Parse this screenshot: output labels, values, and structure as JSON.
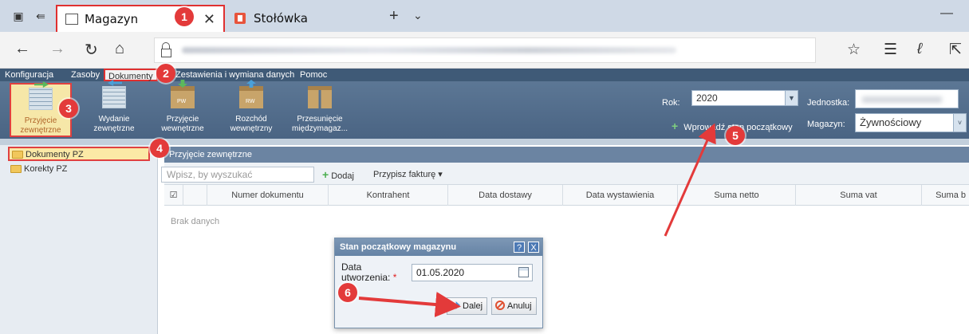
{
  "browser": {
    "tabs": [
      {
        "label": "Magazyn",
        "active": true
      },
      {
        "label": "Stołówka",
        "active": false
      }
    ],
    "url_visible": false
  },
  "menu": {
    "items": [
      "Konfiguracja",
      "Zasoby",
      "Dokumenty",
      "Zestawienia i wymiana danych",
      "Pomoc"
    ]
  },
  "toolbar": {
    "buttons": [
      {
        "label": "Przyjęcie zewnętrzne",
        "icon": "receipt-external-icon"
      },
      {
        "label": "Wydanie zewnętrzne",
        "icon": "issue-external-icon"
      },
      {
        "label": "Przyjęcie wewnętrzne",
        "icon": "pw-box-icon"
      },
      {
        "label": "Rozchód wewnętrzny",
        "icon": "rw-box-icon"
      },
      {
        "label": "Przesunięcie międzymagaz...",
        "icon": "transfer-icon"
      }
    ],
    "rok_label": "Rok:",
    "rok_value": "2020",
    "jednostka_label": "Jednostka:",
    "set_initial_state": "Wprowadź stan początkowy",
    "magazyn_label": "Magazyn:",
    "magazyn_value": "Żywnościowy"
  },
  "sidebar": {
    "items": [
      {
        "label": "Dokumenty PZ",
        "selected": true
      },
      {
        "label": "Korekty PZ",
        "selected": false
      }
    ]
  },
  "main": {
    "title": "Przyjęcie zewnętrzne",
    "search_placeholder": "Wpisz, by wyszukać",
    "add_label": "Dodaj",
    "attach_invoice_label": "Przypisz fakturę ▾",
    "columns": [
      "Numer dokumentu",
      "Kontrahent",
      "Data dostawy",
      "Data wystawienia",
      "Suma netto",
      "Suma vat",
      "Suma b"
    ],
    "empty_text": "Brak danych"
  },
  "dialog": {
    "title": "Stan początkowy magazynu",
    "date_label_line1": "Data",
    "date_label_line2": "utworzenia:",
    "required_mark": "*",
    "date_value": "01.05.2020",
    "next_label": "Dalej",
    "cancel_label": "Anuluj",
    "help_icon": "?",
    "close_icon": "X"
  },
  "annotations": {
    "steps": [
      "1",
      "2",
      "3",
      "4",
      "5",
      "6"
    ],
    "color": "#e33a3a"
  }
}
